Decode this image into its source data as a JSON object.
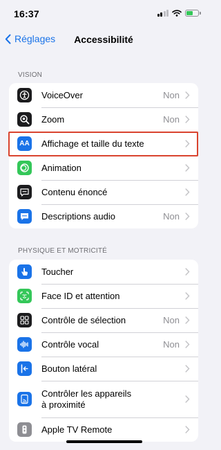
{
  "status_bar": {
    "time": "16:37"
  },
  "nav": {
    "back_label": "Réglages",
    "title": "Accessibilité"
  },
  "vision": {
    "header": "VISION",
    "items": [
      {
        "label": "VoiceOver",
        "value": "Non",
        "icon": "voiceover-icon",
        "color": "#1c1c1e"
      },
      {
        "label": "Zoom",
        "value": "Non",
        "icon": "zoom-icon",
        "color": "#1c1c1e"
      },
      {
        "label": "Affichage et taille du texte",
        "value": "",
        "icon": "text-size-icon",
        "icon_text": "AA",
        "color": "#1a73e8"
      },
      {
        "label": "Animation",
        "value": "",
        "icon": "animation-icon",
        "color": "#34c759"
      },
      {
        "label": "Contenu énoncé",
        "value": "",
        "icon": "spoken-content-icon",
        "color": "#1c1c1e"
      },
      {
        "label": "Descriptions audio",
        "value": "Non",
        "icon": "audio-descriptions-icon",
        "color": "#1a73e8"
      }
    ]
  },
  "physical": {
    "header": "PHYSIQUE ET MOTRICITÉ",
    "items": [
      {
        "label": "Toucher",
        "value": "",
        "icon": "touch-icon",
        "color": "#1a73e8"
      },
      {
        "label": "Face ID et attention",
        "value": "",
        "icon": "face-id-icon",
        "color": "#34c759"
      },
      {
        "label": "Contrôle de sélection",
        "value": "Non",
        "icon": "switch-control-icon",
        "color": "#1c1c1e"
      },
      {
        "label": "Contrôle vocal",
        "value": "Non",
        "icon": "voice-control-icon",
        "color": "#1a73e8"
      },
      {
        "label": "Bouton latéral",
        "value": "",
        "icon": "side-button-icon",
        "color": "#1a73e8"
      },
      {
        "label_line1": "Contrôler les appareils",
        "label_line2": "à proximité",
        "value": "",
        "icon": "nearby-devices-icon",
        "color": "#1a73e8"
      },
      {
        "label": "Apple TV Remote",
        "value": "",
        "icon": "apple-tv-remote-icon",
        "color": "#8e8e93"
      }
    ]
  },
  "colors": {
    "accent": "#1a73e8",
    "highlight": "#d9432e",
    "background": "#f2f2f7"
  }
}
